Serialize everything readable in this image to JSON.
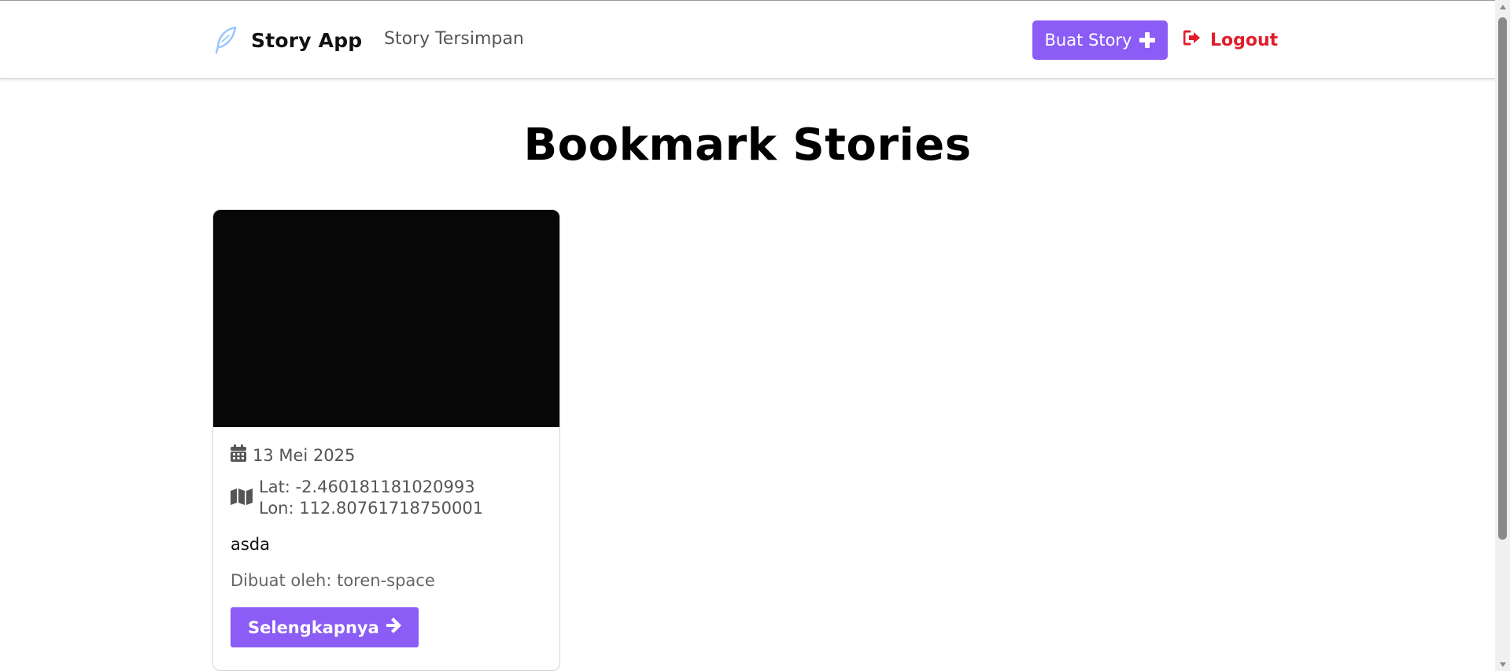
{
  "navbar": {
    "brand": {
      "name": "Story App",
      "icon": "feather-icon"
    },
    "links": [
      {
        "label": "Story Tersimpan"
      }
    ],
    "create_button": {
      "label": "Buat Story",
      "icon": "plus-icon"
    },
    "logout_button": {
      "label": "Logout",
      "icon": "sign-out-icon"
    }
  },
  "page": {
    "title": "Bookmark Stories"
  },
  "stories": [
    {
      "image": "story-photo",
      "date": "13 Mei 2025",
      "lat": "Lat: -2.460181181020993",
      "lon": "Lon: 112.80761718750001",
      "description": "asda",
      "author": "Dibuat oleh: toren-space",
      "detail_label": "Selengkapnya",
      "icons": {
        "date": "calendar-icon",
        "location": "map-icon",
        "detail": "arrow-right-icon"
      }
    }
  ],
  "colors": {
    "accent": "#8b5cf6",
    "logout": "#e11d2a",
    "brand_icon": "#93c5fd",
    "muted_text": "#555555"
  }
}
